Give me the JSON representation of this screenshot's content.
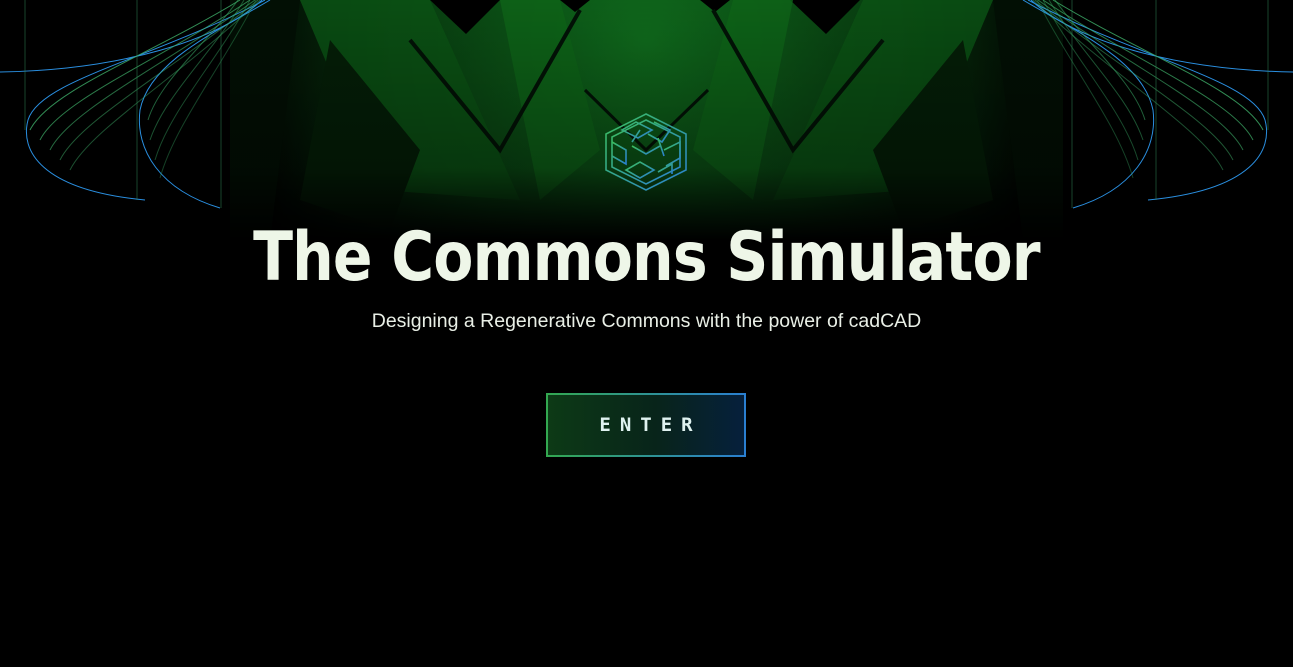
{
  "hero": {
    "title": "The Commons Simulator",
    "subtitle": "Designing a Regenerative Commons with the power of cadCAD",
    "logo_icon": "commons-cube-logo-icon"
  },
  "actions": {
    "enter_label": "ENTER"
  },
  "colors": {
    "background": "#000000",
    "accent_green": "#2f9e44",
    "accent_blue": "#2a7fd2",
    "title_text": "#eef6e8"
  }
}
